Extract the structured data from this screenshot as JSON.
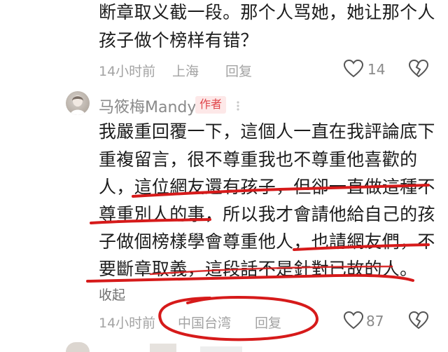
{
  "comment_prev": {
    "lines": [
      "断章取义截一段。那个人骂她，她让那个人",
      "孩子做个榜样有错？"
    ],
    "time": "14小时前",
    "location": "上海",
    "reply_label": "回复",
    "likes": "14"
  },
  "comment_author": {
    "name": "马筱梅Mandy",
    "badge": "作者",
    "lines": [
      "我嚴重回覆一下，這個人一直在我評論底下",
      "重複留言，很不尊重我也不尊重他喜歡的",
      "人，這位網友還有孩子，但卻一直做這種不",
      "尊重別人的事，所以我才會請他給自己的孩",
      "子做個榜樣學會尊重他人，也請網友們，不",
      "要斷章取義，這段話不是針對已故的人。"
    ],
    "collapse_label": "收起",
    "time": "14小时前",
    "location": "中国台湾",
    "reply_label": "回复",
    "likes": "87"
  },
  "colors": {
    "annotation_red": "#d61a1a",
    "badge_red": "#e0454a",
    "meta_gray": "#a3a3a3"
  }
}
